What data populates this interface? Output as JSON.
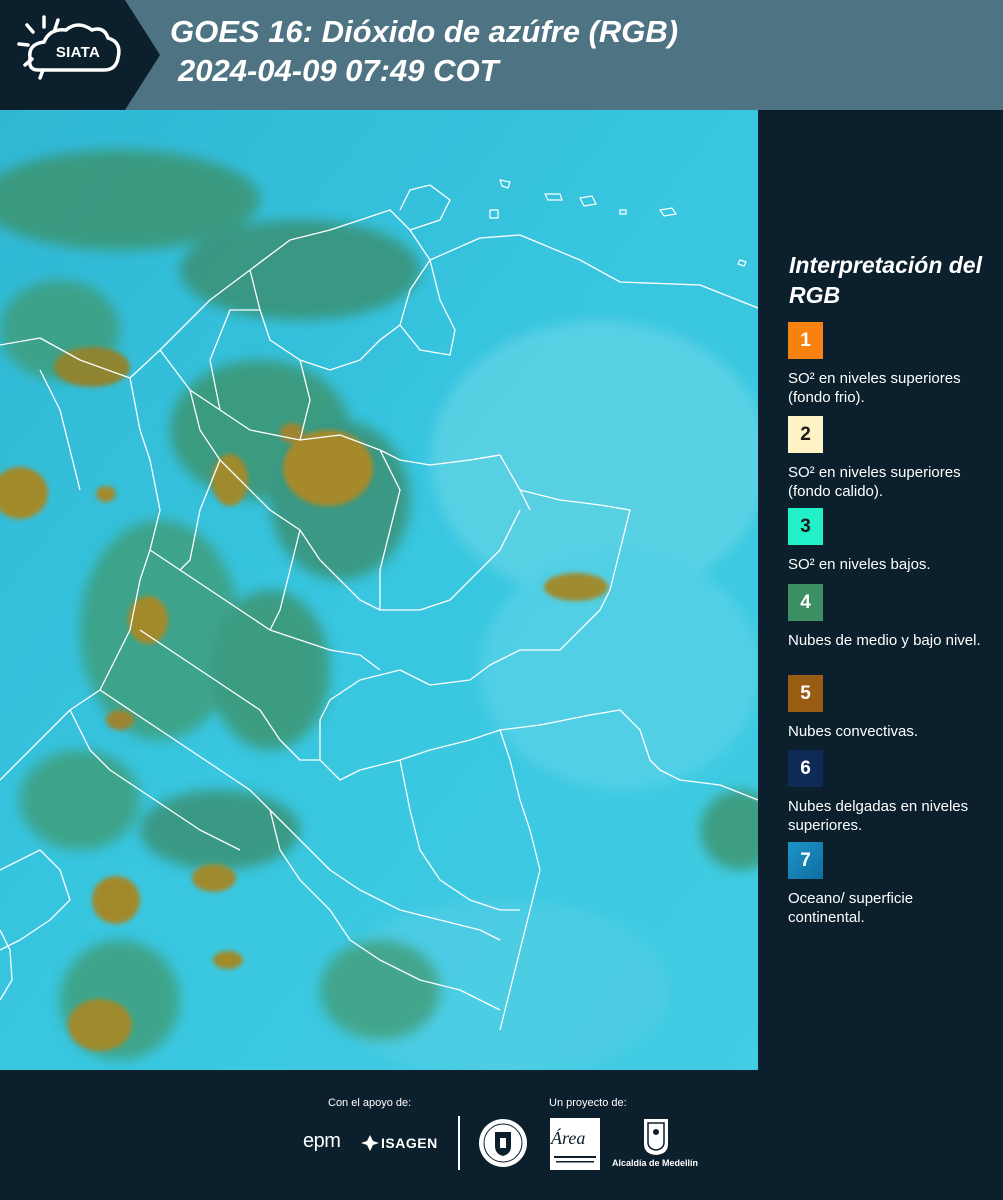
{
  "header": {
    "logo_text": "SIATA",
    "title_line1": "GOES 16: Dióxido de azúfre (RGB)",
    "title_line2": "2024-04-09 07:49 COT",
    "bg_color": "#4e7383"
  },
  "legend": {
    "title": "Interpretación del RGB",
    "items": [
      {
        "number": "1",
        "color": "#f7820f",
        "text_color": "#ffffff",
        "description": "SO² en niveles superiores (fondo frio)."
      },
      {
        "number": "2",
        "color": "#fdf3c4",
        "text_color": "#1a1a1a",
        "description": "SO² en niveles superiores (fondo calido)."
      },
      {
        "number": "3",
        "color": "#21f0c8",
        "text_color": "#1a1a1a",
        "description": "SO² en niveles bajos."
      },
      {
        "number": "4",
        "color": "#3d8f64",
        "text_color": "#ffffff",
        "description": "Nubes de medio y bajo nivel."
      },
      {
        "number": "5",
        "color": "#9a5c12",
        "text_color": "#ffffff",
        "description": "Nubes convectivas."
      },
      {
        "number": "6",
        "color": "#0e2b56",
        "text_color": "#ffffff",
        "description": "Nubes delgadas en niveles superiores."
      },
      {
        "number": "7",
        "color": "#1d93c8",
        "text_color": "#ffffff",
        "description": "Oceano/ superficie continental."
      }
    ]
  },
  "map": {
    "ocean_color": "#34c4df",
    "cloud_color": "#3d8f64",
    "convective_color": "#9a7a2a",
    "border_color": "#ffffff"
  },
  "footer": {
    "support_label": "Con el apoyo de:",
    "project_label": "Un proyecto de:",
    "epm_text": "epm",
    "isagen_text": "ISAGEN",
    "area_text": "Área",
    "alcaldia_text": "Alcaldía de Medellín"
  }
}
